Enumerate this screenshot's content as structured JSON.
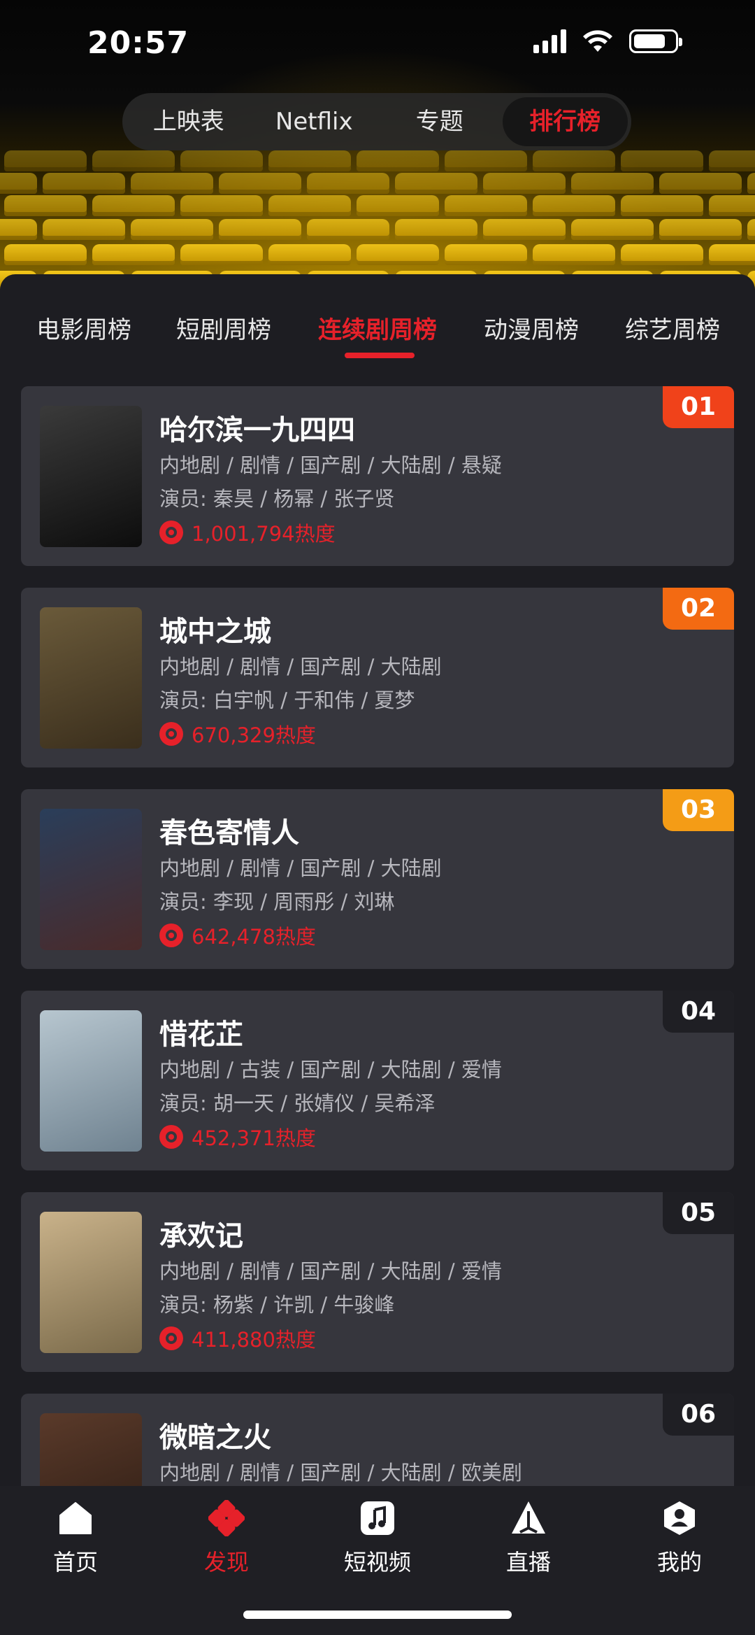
{
  "status_bar": {
    "time": "20:57"
  },
  "top_segments": [
    {
      "label": "上映表",
      "active": false
    },
    {
      "label": "Netflix",
      "active": false
    },
    {
      "label": "专题",
      "active": false
    },
    {
      "label": "排行榜",
      "active": true
    }
  ],
  "category_tabs": [
    {
      "label": "电影周榜",
      "active": false
    },
    {
      "label": "短剧周榜",
      "active": false
    },
    {
      "label": "连续剧周榜",
      "active": true
    },
    {
      "label": "动漫周榜",
      "active": false
    },
    {
      "label": "综艺周榜",
      "active": false
    }
  ],
  "rank_colors": {
    "01": "#f0421a",
    "02": "#f36a12",
    "03": "#f49c16",
    "other": "#1f1f24"
  },
  "accent_color": "#e6212a",
  "list": [
    {
      "rank": "01",
      "title": "哈尔滨一九四四",
      "tags": "内地剧 / 剧情 / 国产剧 / 大陆剧 / 悬疑",
      "cast": "演员: 秦昊 / 杨幂 / 张子贤",
      "heat": "1,001,794热度",
      "poster_colors": [
        "#3a3a3a",
        "#0d0d0d"
      ]
    },
    {
      "rank": "02",
      "title": "城中之城",
      "tags": "内地剧 / 剧情 / 国产剧 / 大陆剧",
      "cast": "演员: 白宇帆 / 于和伟 / 夏梦",
      "heat": "670,329热度",
      "poster_colors": [
        "#6a5a3a",
        "#3a2e1c"
      ]
    },
    {
      "rank": "03",
      "title": "春色寄情人",
      "tags": "内地剧 / 剧情 / 国产剧 / 大陆剧",
      "cast": "演员: 李现 / 周雨彤 / 刘琳",
      "heat": "642,478热度",
      "poster_colors": [
        "#2a3e5a",
        "#4a2a2a"
      ]
    },
    {
      "rank": "04",
      "title": "惜花芷",
      "tags": "内地剧 / 古装 / 国产剧 / 大陆剧 / 爱情",
      "cast": "演员: 胡一天 / 张婧仪 / 吴希泽",
      "heat": "452,371热度",
      "poster_colors": [
        "#b7c6cf",
        "#6f8290"
      ]
    },
    {
      "rank": "05",
      "title": "承欢记",
      "tags": "内地剧 / 剧情 / 国产剧 / 大陆剧 / 爱情",
      "cast": "演员: 杨紫 / 许凯 / 牛骏峰",
      "heat": "411,880热度",
      "poster_colors": [
        "#c9b28a",
        "#7a6a4a"
      ]
    },
    {
      "rank": "06",
      "title": "微暗之火",
      "tags": "内地剧 / 剧情 / 国产剧 / 大陆剧 / 欧美剧",
      "cast": "",
      "heat": "",
      "poster_colors": [
        "#5a3a2a",
        "#2a1a12"
      ]
    }
  ],
  "bottom_nav": [
    {
      "label": "首页",
      "icon": "home-icon",
      "active": false
    },
    {
      "label": "发现",
      "icon": "discover-icon",
      "active": true
    },
    {
      "label": "短视频",
      "icon": "music-note-icon",
      "active": false
    },
    {
      "label": "直播",
      "icon": "live-icon",
      "active": false
    },
    {
      "label": "我的",
      "icon": "profile-icon",
      "active": false
    }
  ]
}
